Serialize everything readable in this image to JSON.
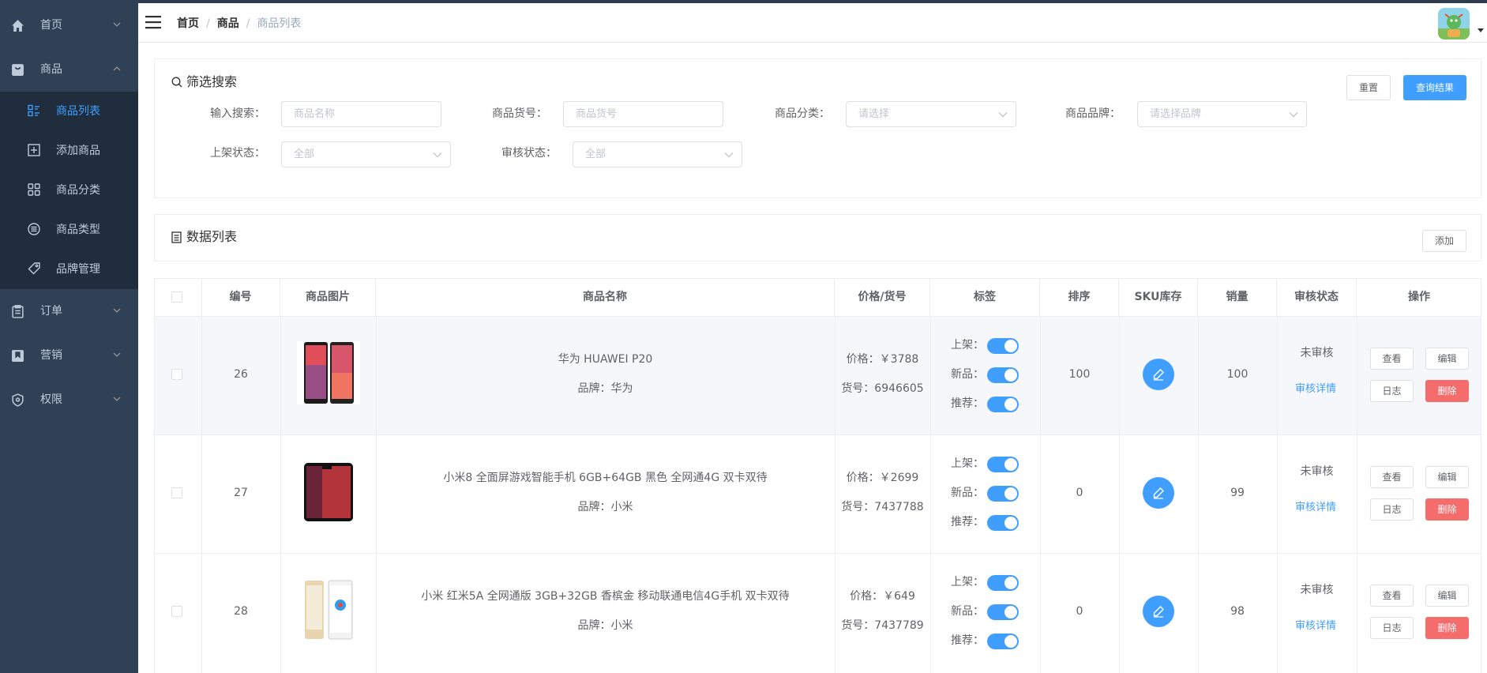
{
  "sidebar": {
    "menus": [
      {
        "label": "首页",
        "icon": "home-icon"
      },
      {
        "label": "商品",
        "icon": "shopping-bag-icon"
      },
      {
        "label": "订单",
        "icon": "clipboard-icon"
      },
      {
        "label": "营销",
        "icon": "bookmark-icon"
      },
      {
        "label": "权限",
        "icon": "shield-icon"
      }
    ],
    "submenu": [
      {
        "label": "商品列表",
        "icon": "list-icon",
        "active": true
      },
      {
        "label": "添加商品",
        "icon": "plus-square-icon"
      },
      {
        "label": "商品分类",
        "icon": "grid-icon"
      },
      {
        "label": "商品类型",
        "icon": "list-circle-icon"
      },
      {
        "label": "品牌管理",
        "icon": "tag-icon"
      }
    ]
  },
  "breadcrumb": {
    "home": "首页",
    "parent": "商品",
    "current": "商品列表"
  },
  "filter": {
    "title": "筛选搜索",
    "reset_label": "重置",
    "query_label": "查询结果",
    "fields": {
      "keyword": {
        "label": "输入搜索：",
        "placeholder": "商品名称"
      },
      "sn": {
        "label": "商品货号：",
        "placeholder": "商品货号"
      },
      "category": {
        "label": "商品分类：",
        "placeholder": "请选择"
      },
      "brand": {
        "label": "商品品牌：",
        "placeholder": "请选择品牌"
      },
      "publish": {
        "label": "上架状态：",
        "placeholder": "全部"
      },
      "verify": {
        "label": "审核状态：",
        "placeholder": "全部"
      }
    }
  },
  "list": {
    "title": "数据列表",
    "add_label": "添加"
  },
  "table": {
    "headers": [
      "编号",
      "商品图片",
      "商品名称",
      "价格/货号",
      "标签",
      "排序",
      "SKU库存",
      "销量",
      "审核状态",
      "操作"
    ],
    "tag_labels": {
      "publish": "上架：",
      "new": "新品：",
      "recommend": "推荐："
    },
    "actions": {
      "view": "查看",
      "edit": "编辑",
      "log": "日志",
      "delete": "删除"
    },
    "rows": [
      {
        "id": "26",
        "name": "华为 HUAWEI P20",
        "brand": "品牌：华为",
        "price": "价格：￥3788",
        "sn": "货号：6946605",
        "publish": true,
        "new": true,
        "recommend": true,
        "sort": "100",
        "sales": "100",
        "status": "未审核",
        "detail": "审核详情",
        "phone_color": "#e04e5a"
      },
      {
        "id": "27",
        "name": "小米8 全面屏游戏智能手机 6GB+64GB 黑色 全网通4G 双卡双待",
        "brand": "品牌：小米",
        "price": "价格：￥2699",
        "sn": "货号：7437788",
        "publish": true,
        "new": true,
        "recommend": true,
        "sort": "0",
        "sales": "99",
        "status": "未审核",
        "detail": "审核详情",
        "phone_color": "#c0504d"
      },
      {
        "id": "28",
        "name": "小米 红米5A 全网通版 3GB+32GB 香槟金 移动联通电信4G手机 双卡双待",
        "brand": "品牌：小米",
        "price": "价格：￥649",
        "sn": "货号：7437789",
        "publish": true,
        "new": true,
        "recommend": true,
        "sort": "0",
        "sales": "98",
        "status": "未审核",
        "detail": "审核详情",
        "phone_color": "#2a9df4"
      }
    ]
  },
  "colors": {
    "sidebar_bg": "#304156",
    "submenu_bg": "#1f2d3d",
    "accent": "#409eff",
    "danger": "#f56c6c"
  }
}
